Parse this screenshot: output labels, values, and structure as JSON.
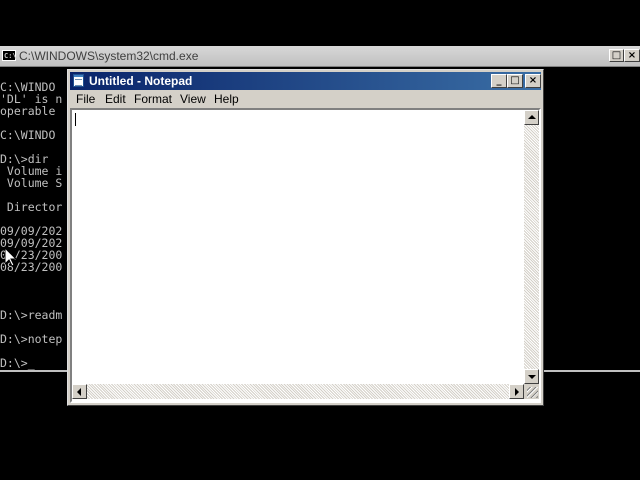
{
  "cmd": {
    "title": "C:\\WINDOWS\\system32\\cmd.exe",
    "icon_label": "C:\\",
    "controls": {
      "minimize": "_",
      "maximize": "□",
      "close": "×"
    },
    "lines": [
      "C:\\WINDO",
      "'DL' is n",
      "operable",
      "",
      "C:\\WINDO",
      "",
      "D:\\>dir",
      " Volume i",
      " Volume S",
      "",
      " Director",
      "",
      "09/09/202",
      "09/09/202",
      "0 /23/200",
      "08/23/200",
      "",
      "",
      "",
      "D:\\>readm",
      "",
      "D:\\>notep",
      "",
      "D:\\>_"
    ]
  },
  "notepad": {
    "title": "Untitled - Notepad",
    "controls": {
      "minimize": "_",
      "maximize": "□",
      "close": "×"
    },
    "menu": [
      "File",
      "Edit",
      "Format",
      "View",
      "Help"
    ],
    "content": ""
  }
}
